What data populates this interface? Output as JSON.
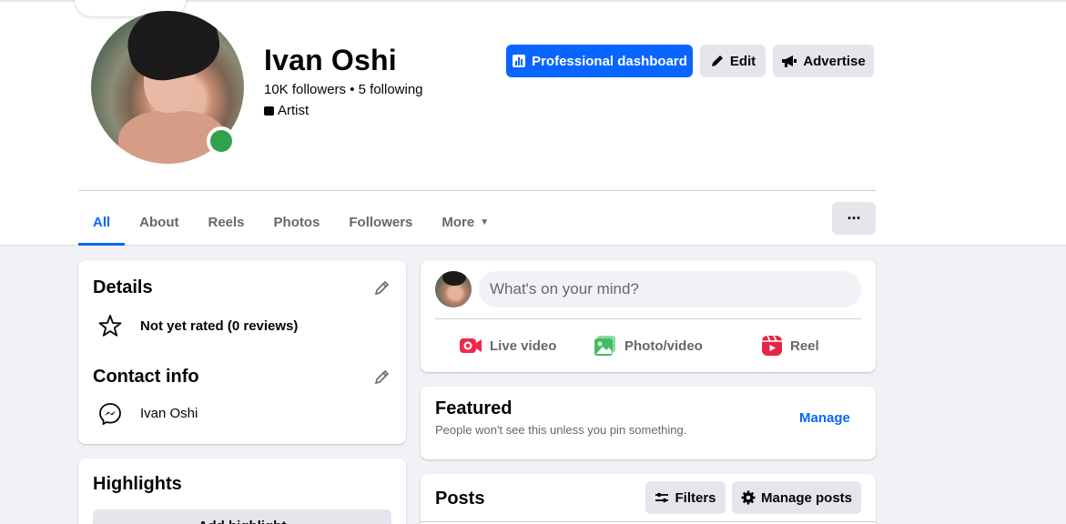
{
  "profile": {
    "name": "Ivan Oshi",
    "followers": "10K followers",
    "following": "5 following",
    "separator": " • ",
    "category": "Artist"
  },
  "actions": {
    "professional_dashboard": "Professional dashboard",
    "edit": "Edit",
    "advertise": "Advertise",
    "more": "···"
  },
  "tabs": [
    {
      "label": "All",
      "active": true
    },
    {
      "label": "About"
    },
    {
      "label": "Reels"
    },
    {
      "label": "Photos"
    },
    {
      "label": "Followers"
    },
    {
      "label": "More"
    }
  ],
  "details": {
    "title": "Details",
    "rating": "Not yet rated (0 reviews)",
    "contact_title": "Contact info",
    "messenger": "Ivan Oshi"
  },
  "highlights": {
    "title": "Highlights",
    "add_button": "Add highlight"
  },
  "create_post": {
    "placeholder": "What's on your mind?",
    "live_video": "Live video",
    "photo_video": "Photo/video",
    "reel": "Reel"
  },
  "featured": {
    "title": "Featured",
    "subtitle": "People won't see this unless you pin something.",
    "manage": "Manage"
  },
  "posts": {
    "title": "Posts",
    "filters": "Filters",
    "manage_posts": "Manage posts"
  },
  "colors": {
    "accent": "#0866ff",
    "online": "#31a24c",
    "live": "#f02849",
    "photo": "#45bd62",
    "reel": "#e42645"
  }
}
